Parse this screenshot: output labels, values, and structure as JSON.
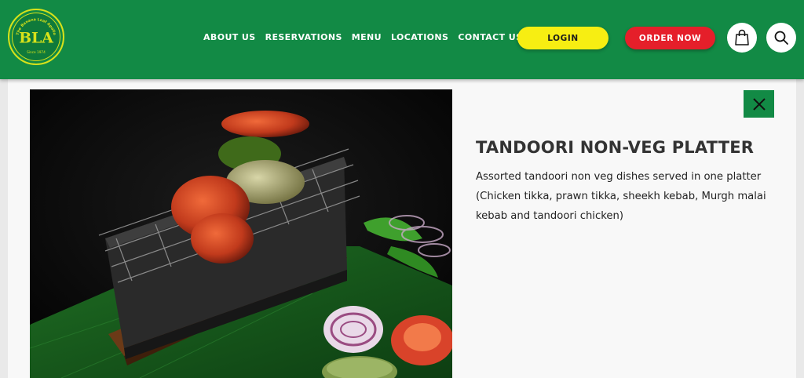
{
  "header": {
    "logo": {
      "ring_text": "The Banana Leaf Apollo",
      "monogram": "BLA",
      "since": "Since 1974"
    },
    "nav": [
      {
        "label": "ABOUT US"
      },
      {
        "label": "RESERVATIONS"
      },
      {
        "label": "MENU"
      },
      {
        "label": "LOCATIONS"
      },
      {
        "label": "CONTACT US"
      }
    ],
    "login_label": "LOGIN",
    "order_label": "ORDER NOW",
    "cart_icon": "shopping-bag-icon",
    "search_icon": "search-icon"
  },
  "item": {
    "title": "TANDOORI NON-VEG PLATTER",
    "description": "Assorted tandoori non veg dishes served in one platter (Chicken tikka, prawn tikka, sheekh kebab, Murgh malai kebab and tandoori chicken)",
    "close_icon": "close-icon"
  },
  "colors": {
    "brand_green": "#128a45",
    "login_yellow": "#f7ee12",
    "order_red": "#e51f2a"
  }
}
